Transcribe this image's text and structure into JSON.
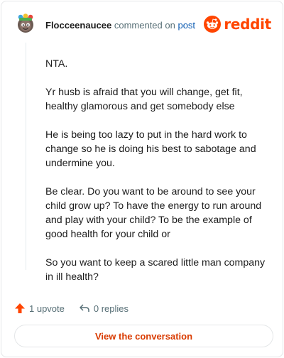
{
  "header": {
    "username": "Flocceenaucee",
    "verb": "commented on",
    "post_link": "post",
    "brand": "reddit",
    "avatar_icon": "snoo-avatar-icon",
    "brand_icon": "reddit-snoo-icon",
    "brand_color": "#ff4500"
  },
  "comment": {
    "paragraphs": [
      "NTA.",
      "Yr husb is afraid that you will change, get fit, healthy glamorous and get somebody else",
      "He is being too lazy to put in the hard work to change so he is doing his best to sabotage and undermine you.",
      "Be clear. Do you want to be around to see your child grow up? To have the energy to run around and play with your child? To be the example of good health for your child or",
      "So you want to keep a scared little man company in ill health?"
    ]
  },
  "actions": {
    "upvote_label": "1 upvote",
    "upvote_icon": "upvote-arrow-icon",
    "upvote_color": "#ff4500",
    "replies_label": "0 replies",
    "replies_icon": "reply-arrow-icon"
  },
  "cta": {
    "label": "View the conversation",
    "color": "#d93a00"
  }
}
